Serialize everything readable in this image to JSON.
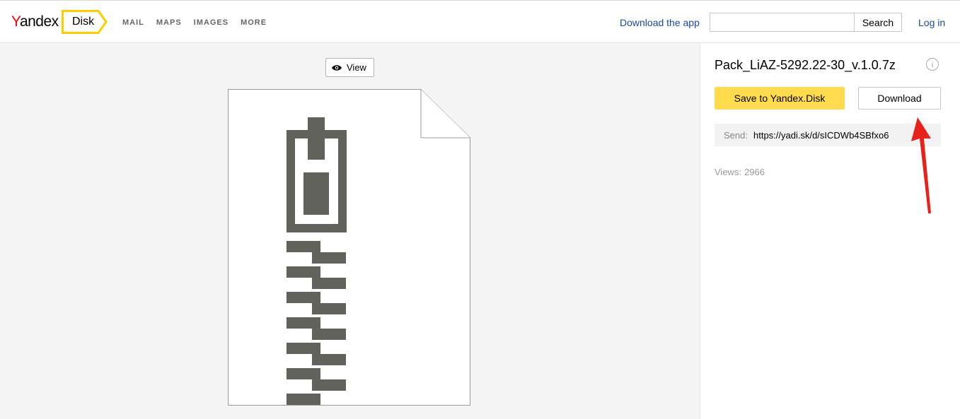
{
  "header": {
    "logo": {
      "first": "Y",
      "rest": "andex"
    },
    "service": "Disk",
    "nav": [
      "MAIL",
      "MAPS",
      "IMAGES",
      "MORE"
    ],
    "download_app": "Download the app",
    "search": {
      "value": "",
      "placeholder": "",
      "button": "Search"
    },
    "login": "Log in"
  },
  "preview": {
    "view_button": "View",
    "file_icon": "zip-archive-icon"
  },
  "sidebar": {
    "filename": "Pack_LiAZ-5292.22-30_v.1.0.7z",
    "info_icon": "i",
    "save_button": "Save to Yandex.Disk",
    "download_button": "Download",
    "share_label": "Send:",
    "share_url": "https://yadi.sk/d/sICDWb4SBfxo6",
    "views_label": "Views:",
    "views_count": "2966"
  },
  "colors": {
    "accent_yellow": "#ffdb4d",
    "link_blue": "#1a49a8",
    "annotation_red": "#e8221b",
    "zip_gray": "#62625c"
  }
}
